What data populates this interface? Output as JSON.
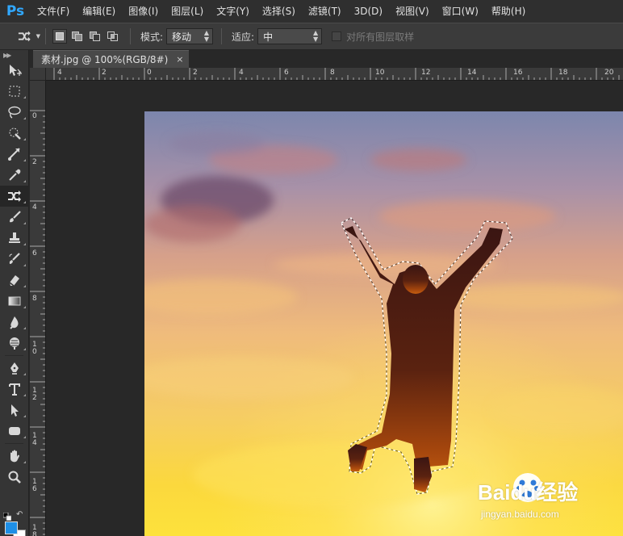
{
  "app": {
    "logo": "Ps"
  },
  "menu": [
    "文件(F)",
    "编辑(E)",
    "图像(I)",
    "图层(L)",
    "文字(Y)",
    "选择(S)",
    "滤镜(T)",
    "3D(D)",
    "视图(V)",
    "窗口(W)",
    "帮助(H)"
  ],
  "options": {
    "tool_icon": "content-aware-move-icon",
    "mode_label": "模式:",
    "mode_value": "移动",
    "adapt_label": "适应:",
    "adapt_value": "中",
    "sample_all_layers_label": "对所有图层取样",
    "sample_all_layers_checked": false
  },
  "document": {
    "tab_label": "素材.jpg @ 100%(RGB/8#)",
    "close_glyph": "×"
  },
  "rulers": {
    "horizontal": [
      "4",
      "2",
      "0",
      "2",
      "4",
      "6",
      "8",
      "10",
      "12",
      "14",
      "16",
      "18",
      "20"
    ],
    "vertical": [
      "0",
      "2",
      "4",
      "6",
      "8",
      "10",
      "12",
      "14",
      "16",
      "18"
    ]
  },
  "tools": [
    "move-icon",
    "marquee-icon",
    "lasso-icon",
    "quick-selection-icon",
    "crop-icon",
    "eyedropper-icon",
    "content-aware-move-icon",
    "brush-icon",
    "stamp-icon",
    "history-brush-icon",
    "eraser-icon",
    "gradient-icon",
    "blur-icon",
    "dodge-icon",
    "pen-icon",
    "type-icon",
    "path-selection-icon",
    "shape-icon",
    "hand-icon",
    "zoom-icon"
  ],
  "active_tool": "content-aware-move-icon",
  "colors": {
    "accent": "#31a8ff",
    "foreground": "#1e8fe6",
    "background": "#ffffff"
  },
  "watermark": {
    "brand": "Baidu经验",
    "url": "jingyan.baidu.com"
  }
}
